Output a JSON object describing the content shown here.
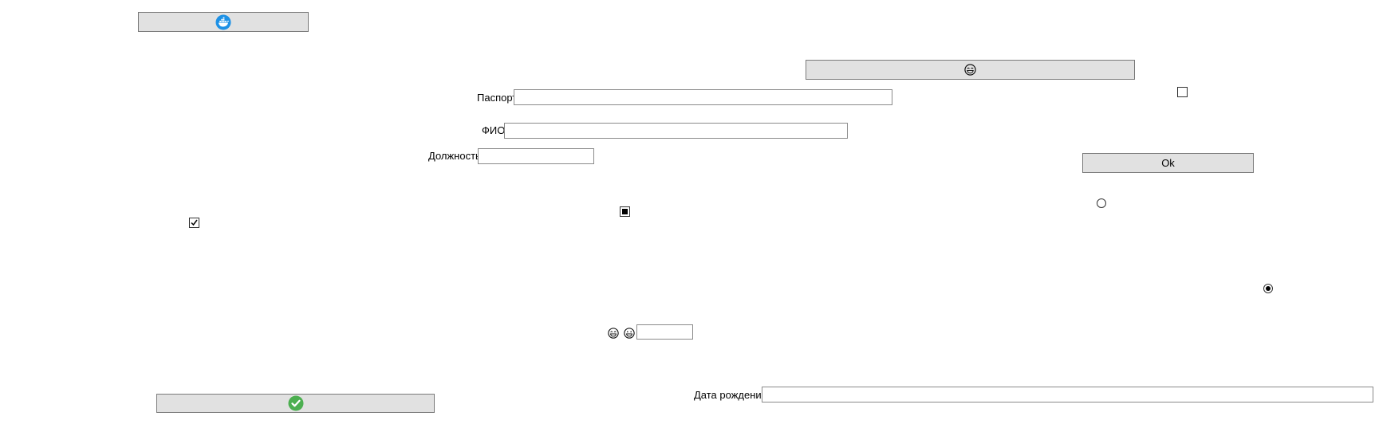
{
  "form": {
    "passport_label": "Паспорт",
    "passport_value": "",
    "fio_label": "ФИО",
    "fio_value": "",
    "position_label": "Должность",
    "position_value": "",
    "birthdate_label": "Дата рождения",
    "birthdate_value": "",
    "small_field_value": ""
  },
  "buttons": {
    "ok_label": "Ok",
    "docker_button_icon": "docker-icon",
    "emoji_button_icon": "laughing-emoji-icon",
    "confirm_button_icon": "check-circle-icon"
  },
  "controls": {
    "checkbox_top_right_checked": false,
    "checkbox_left_checked": true,
    "checkbox_middle_state": "indeterminate",
    "radio_top_selected": false,
    "radio_bottom_selected": true
  },
  "colors": {
    "button_bg": "#e1e1e1",
    "docker_blue": "#1d91e6",
    "check_green": "#4caf50"
  }
}
